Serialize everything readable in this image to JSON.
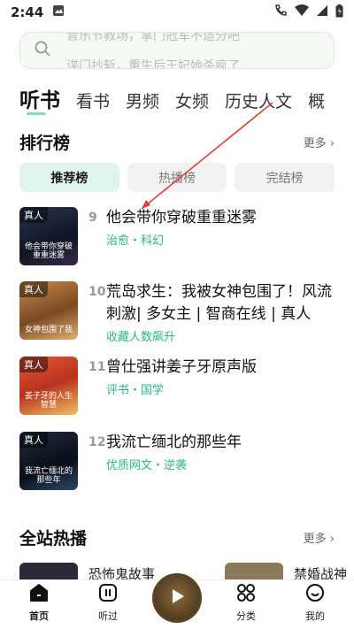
{
  "status_bar": {
    "time": "2:44"
  },
  "search": {
    "line1": "音乐节教场，掌门冠军不适分吧",
    "line2": "谍门抄斩，重生后王妃她杀疯了"
  },
  "top_tabs": [
    "听书",
    "看书",
    "男频",
    "女频",
    "历史人文",
    "概"
  ],
  "ranking": {
    "title": "排行榜",
    "more": "更多 ›",
    "subtabs": [
      "推荐榜",
      "热播榜",
      "完结榜"
    ],
    "books": [
      {
        "rank": "9",
        "title": "他会带你穿破重重迷雾",
        "meta": "治愈・科幻",
        "tag": "真人",
        "cover_text": "他会带你穿破重重迷雾"
      },
      {
        "rank": "10",
        "title": "荒岛求生：我被女神包围了！风流刺激| 多女主 | 智商在线 | 真人",
        "meta": "收藏人数飙升",
        "tag": "真人",
        "cover_text": "女神包围了我"
      },
      {
        "rank": "11",
        "title": "曾仕强讲姜子牙原声版",
        "meta": "评书・国学",
        "tag": "真人",
        "cover_text": "姜子牙的人生智慧"
      },
      {
        "rank": "12",
        "title": "我流亡缅北的那些年",
        "meta": "优质网文・逆袭",
        "tag": "真人",
        "cover_text": "我流亡缅北的那些年"
      }
    ]
  },
  "hot": {
    "title": "全站热播",
    "more": "更多 ›",
    "items": [
      "恐怖鬼故事",
      "禁婚战神"
    ]
  },
  "bottom_nav": [
    "首页",
    "听过",
    "分类",
    "我的"
  ],
  "colors": {
    "accent": "#2bb58a",
    "subtab_active_bg": "#dff4ea",
    "annotation_arrow": "#e03a3a"
  }
}
